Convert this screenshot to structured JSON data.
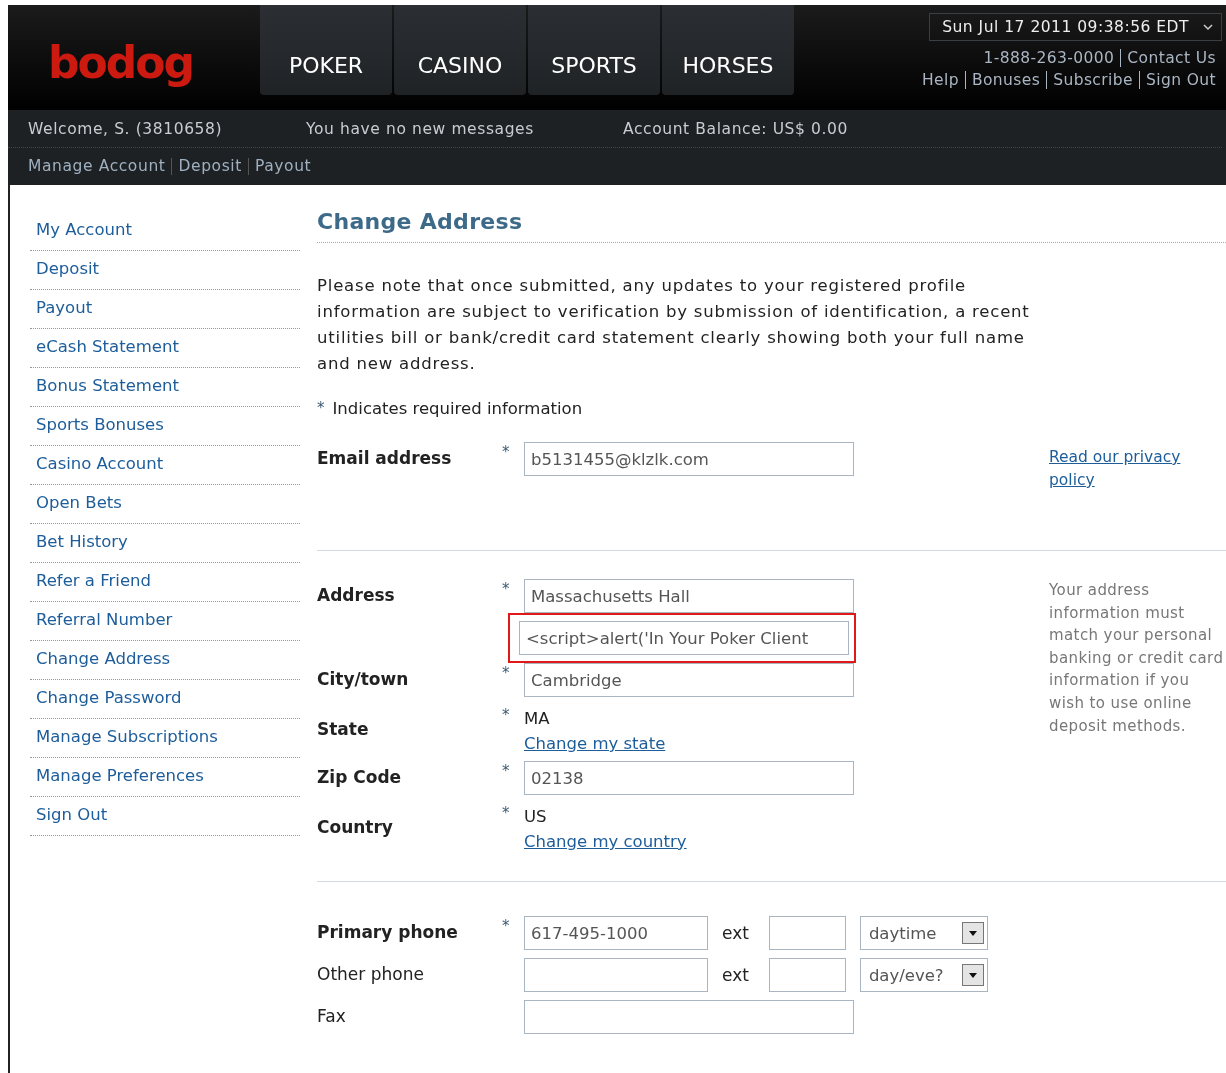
{
  "header": {
    "logo": "bodog",
    "nav_tabs": [
      {
        "label": "POKER"
      },
      {
        "label": "CASINO"
      },
      {
        "label": "SPORTS"
      },
      {
        "label": "HORSES"
      }
    ],
    "datetime": "Sun Jul 17 2011 09:38:56 EDT",
    "contact_links": [
      "1-888-263-0000",
      "Contact Us"
    ],
    "utility_links": [
      "Help",
      "Bonuses",
      "Subscribe",
      "Sign Out"
    ]
  },
  "account_bar": {
    "welcome": "Welcome, S. (3810658)",
    "messages": "You have no new messages",
    "balance": "Account Balance: US$ 0.00",
    "links": [
      "Manage Account",
      "Deposit",
      "Payout"
    ]
  },
  "sidebar": {
    "items": [
      "My Account",
      "Deposit",
      "Payout",
      "eCash Statement",
      "Bonus Statement",
      "Sports Bonuses",
      "Casino Account",
      "Open Bets",
      "Bet History",
      "Refer a Friend",
      "Referral Number",
      "Change Address",
      "Change Password",
      "Manage Subscriptions",
      "Manage Preferences",
      "Sign Out"
    ]
  },
  "main": {
    "title": "Change Address",
    "intro": "Please note that once submitted, any updates to your registered profile information are subject to verification by submission of identification, a recent utilities bill or bank/credit card statement clearly showing both your full name and new address.",
    "required_mark": "*",
    "required_note": "Indicates required information",
    "sections": [
      {
        "aside": {
          "kind": "link",
          "text": "Read our privacy policy"
        },
        "fields": [
          {
            "kind": "input",
            "label": "Email address",
            "bold": true,
            "required": true,
            "value": "b5131455@klzlk.com",
            "highlighted": false
          }
        ]
      },
      {
        "aside": {
          "kind": "note",
          "text": "Your address information must match your personal banking or credit card information if you wish to use online deposit methods."
        },
        "fields": [
          {
            "kind": "input",
            "label": "Address",
            "bold": true,
            "required": true,
            "value": "Massachusetts Hall",
            "highlighted": false
          },
          {
            "kind": "input",
            "required": false,
            "value": "<script>alert('In Your Poker Client",
            "highlighted": true
          },
          {
            "kind": "input",
            "label": "City/town",
            "bold": true,
            "required": true,
            "value": "Cambridge",
            "highlighted": false
          },
          {
            "kind": "static",
            "label": "State",
            "bold": true,
            "required": true,
            "value": "MA",
            "link": "Change my state"
          },
          {
            "kind": "input",
            "label": "Zip Code",
            "bold": true,
            "required": true,
            "value": "02138",
            "highlighted": false
          },
          {
            "kind": "static",
            "label": "Country",
            "bold": true,
            "required": true,
            "value": "US",
            "link": "Change my country"
          }
        ]
      },
      {
        "fields": [
          {
            "kind": "phone",
            "label": "Primary phone",
            "bold": true,
            "required": true,
            "value": "617-495-1000",
            "ext_label": "ext",
            "select": "daytime"
          },
          {
            "kind": "phone",
            "label": "Other phone",
            "bold": false,
            "required": false,
            "ext_label": "ext",
            "select": "day/eve?"
          },
          {
            "kind": "input",
            "label": "Fax",
            "bold": false,
            "required": false,
            "highlighted": false
          }
        ]
      }
    ]
  }
}
